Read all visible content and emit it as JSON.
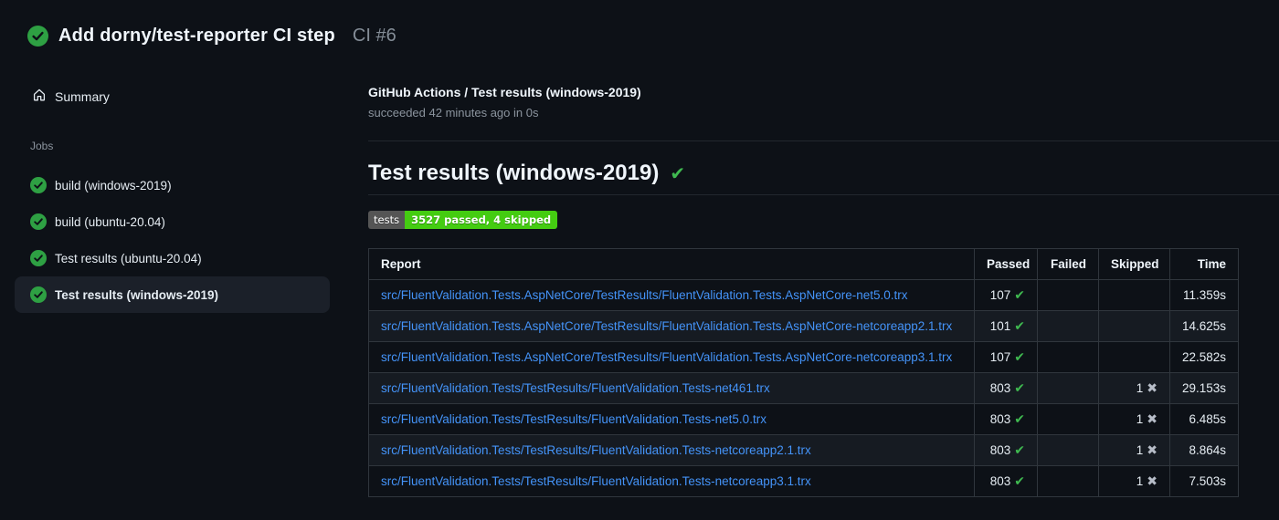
{
  "run_header": {
    "title": "Add dorny/test-reporter CI step",
    "run_ref": "CI #6"
  },
  "sidebar": {
    "summary_label": "Summary",
    "jobs_heading": "Jobs",
    "jobs": [
      {
        "label": "build (windows-2019)",
        "selected": false
      },
      {
        "label": "build (ubuntu-20.04)",
        "selected": false
      },
      {
        "label": "Test results (ubuntu-20.04)",
        "selected": false
      },
      {
        "label": "Test results (windows-2019)",
        "selected": true
      }
    ]
  },
  "main": {
    "check_title": "GitHub Actions / Test results (windows-2019)",
    "check_status": "succeeded 42 minutes ago in 0s",
    "heading": "Test results (windows-2019)",
    "heading_check": "✔",
    "badge": {
      "label": "tests",
      "value": "3527 passed, 4 skipped"
    },
    "table": {
      "headers": {
        "report": "Report",
        "passed": "Passed",
        "failed": "Failed",
        "skipped": "Skipped",
        "time": "Time"
      },
      "rows": [
        {
          "report": "src/FluentValidation.Tests.AspNetCore/TestResults/FluentValidation.Tests.AspNetCore-net5.0.trx",
          "passed": "107",
          "failed": "",
          "skipped": "",
          "time": "11.359s"
        },
        {
          "report": "src/FluentValidation.Tests.AspNetCore/TestResults/FluentValidation.Tests.AspNetCore-netcoreapp2.1.trx",
          "passed": "101",
          "failed": "",
          "skipped": "",
          "time": "14.625s"
        },
        {
          "report": "src/FluentValidation.Tests.AspNetCore/TestResults/FluentValidation.Tests.AspNetCore-netcoreapp3.1.trx",
          "passed": "107",
          "failed": "",
          "skipped": "",
          "time": "22.582s"
        },
        {
          "report": "src/FluentValidation.Tests/TestResults/FluentValidation.Tests-net461.trx",
          "passed": "803",
          "failed": "",
          "skipped": "1",
          "time": "29.153s"
        },
        {
          "report": "src/FluentValidation.Tests/TestResults/FluentValidation.Tests-net5.0.trx",
          "passed": "803",
          "failed": "",
          "skipped": "1",
          "time": "6.485s"
        },
        {
          "report": "src/FluentValidation.Tests/TestResults/FluentValidation.Tests-netcoreapp2.1.trx",
          "passed": "803",
          "failed": "",
          "skipped": "1",
          "time": "8.864s"
        },
        {
          "report": "src/FluentValidation.Tests/TestResults/FluentValidation.Tests-netcoreapp3.1.trx",
          "passed": "803",
          "failed": "",
          "skipped": "1",
          "time": "7.503s"
        }
      ]
    }
  },
  "icons": {
    "passed_check": "✔",
    "skipped_x": "✖"
  },
  "colors": {
    "bg": "#0d1117",
    "success_circle_green": "#2ea043",
    "check_green": "#3fb950",
    "link_blue": "#4493f8",
    "badge_label_bg": "#555555",
    "badge_value_bg": "#44cc11"
  }
}
